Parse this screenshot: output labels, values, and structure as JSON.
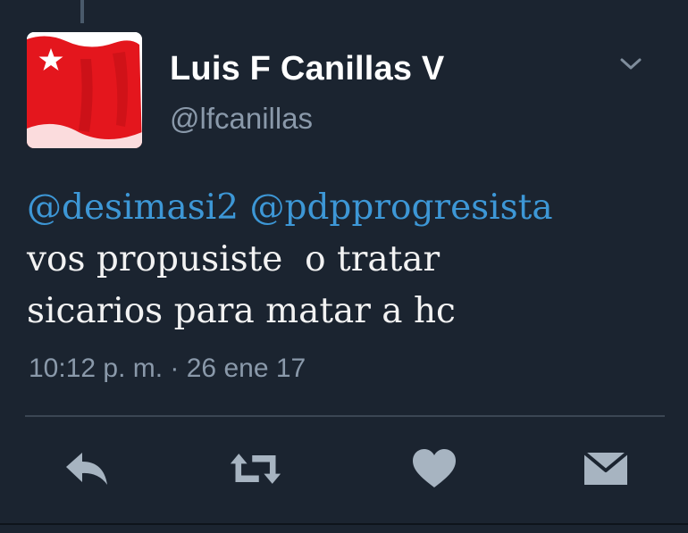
{
  "tweet": {
    "author": {
      "display_name": "Luis F Canillas V",
      "handle": "@lfcanillas",
      "avatar": "red-flag-with-white-star"
    },
    "body": {
      "mentions": [
        "@desimasi2",
        "@pdpprogresista"
      ],
      "lines": [
        "vos propusiste  o tratar",
        "sicarios para matar a hc"
      ]
    },
    "timestamp": "10:12 p. m. · 26 ene 17"
  },
  "actions": {
    "reply": "reply-icon",
    "retweet": "retweet-icon",
    "like": "heart-icon",
    "message": "envelope-icon",
    "menu": "chevron-down-icon"
  },
  "colors": {
    "background": "#1b2430",
    "mention": "#3d97d6",
    "secondary_text": "#8a99aa",
    "icon": "#a7b4c1",
    "avatar_flag": "#e4161d"
  }
}
